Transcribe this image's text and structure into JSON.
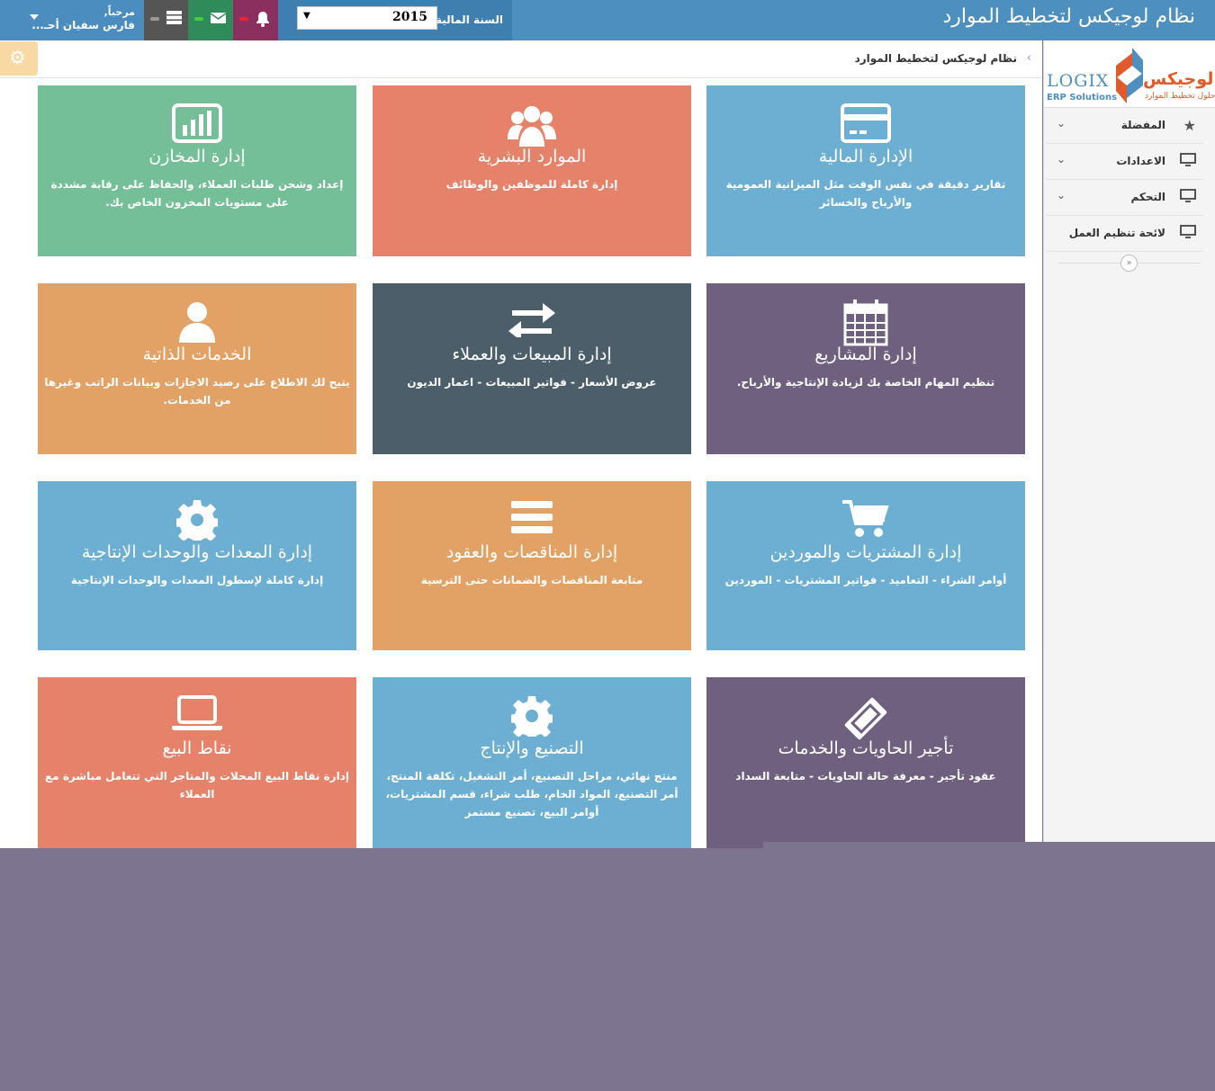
{
  "header": {
    "app_title": "نظام لوجيكس لتخطيط الموارد",
    "fiscal_year_label": "السنة المالية",
    "fiscal_year_value": "2015",
    "welcome": "مرحباً,",
    "user_name": "فارس سفيان أحـ..."
  },
  "breadcrumb": {
    "current": "نظام لوجيكس لتخطيط الموارد"
  },
  "logo": {
    "latin": "LOGIX",
    "latin_sub": "ERP Solutions",
    "arabic": "لوجيكس",
    "arabic_sub": "حلول تخطيط الموارد"
  },
  "sidebar": {
    "items": [
      {
        "label": "المفضلة",
        "icon": "star-icon"
      },
      {
        "label": "الاعدادات",
        "icon": "monitor-icon"
      },
      {
        "label": "التحكم",
        "icon": "monitor-icon"
      },
      {
        "label": "لائحة تنظيم العمل",
        "icon": "monitor-icon"
      }
    ]
  },
  "tiles": [
    {
      "title": "إدارة المخازن",
      "desc": "إعداد وشحن طلبات العملاء، والحفاظ على رقابة مشددة على مستويات المخزون الخاص بك.",
      "icon": "bar-chart-icon",
      "color": "#74bf97"
    },
    {
      "title": "الموارد البشرية",
      "desc": "إدارة كاملة للموظفين والوظائف",
      "icon": "users-icon",
      "color": "#e6826a"
    },
    {
      "title": "الإدارة المالية",
      "desc": "تقارير دقيقة في نفس الوقت مثل الميزانية العمومية والأرباح والخسائر",
      "icon": "credit-card-icon",
      "color": "#6cafd2"
    },
    {
      "title": "الخدمات الذاتية",
      "desc": "يتيح لك الاطلاع على رصيد الاجازات وبيانات الراتب وغيرها من الخدمات.",
      "icon": "user-icon",
      "color": "#e2a165"
    },
    {
      "title": "إدارة المبيعات والعملاء",
      "desc": "عروض الأسعار - فواتير المبيعات - اعمار الديون",
      "icon": "exchange-icon",
      "color": "#4b5e6a"
    },
    {
      "title": "إدارة المشاريع",
      "desc": "تنظيم المهام الخاصة بك لزيادة الإنتاجية والأرباح.",
      "icon": "calendar-icon",
      "color": "#6f607f"
    },
    {
      "title": "إدارة المعدات والوحدات الإنتاجية",
      "desc": "إدارة كاملة لإسطول المعدات والوحدات الإنتاجية",
      "icon": "gear-icon",
      "color": "#6cafd2"
    },
    {
      "title": "إدارة المناقصات والعقود",
      "desc": "متابعة المناقصات والضمانات حتى الترسية",
      "icon": "list-icon",
      "color": "#e2a165"
    },
    {
      "title": "إدارة المشتريات والموردين",
      "desc": "أوامر الشراء - التعاميد - فواتير المشتريات - الموردين",
      "icon": "cart-icon",
      "color": "#6cafd2"
    },
    {
      "title": "نقاط البيع",
      "desc": "إدارة نقاط البيع المحلات والمتاجر التي تتعامل مباشرة مع العملاء",
      "icon": "laptop-icon",
      "color": "#e6826a"
    },
    {
      "title": "التصنيع والإنتاج",
      "desc": "منتج نهائي، مراحل التصنيع، أمر التشغيل، تكلفة المنتج، أمر التصنيع، المواد الخام، طلب شراء، قسم المشتريات، أوامر البيع، تصنيع مستمر",
      "icon": "gear-icon",
      "color": "#6cafd2"
    },
    {
      "title": "تأجير الحاويات والخدمات",
      "desc": "عقود تأجير - معرفة حالة الحاويات - متابعة السداد",
      "icon": "ticket-icon",
      "color": "#6f607f"
    }
  ]
}
